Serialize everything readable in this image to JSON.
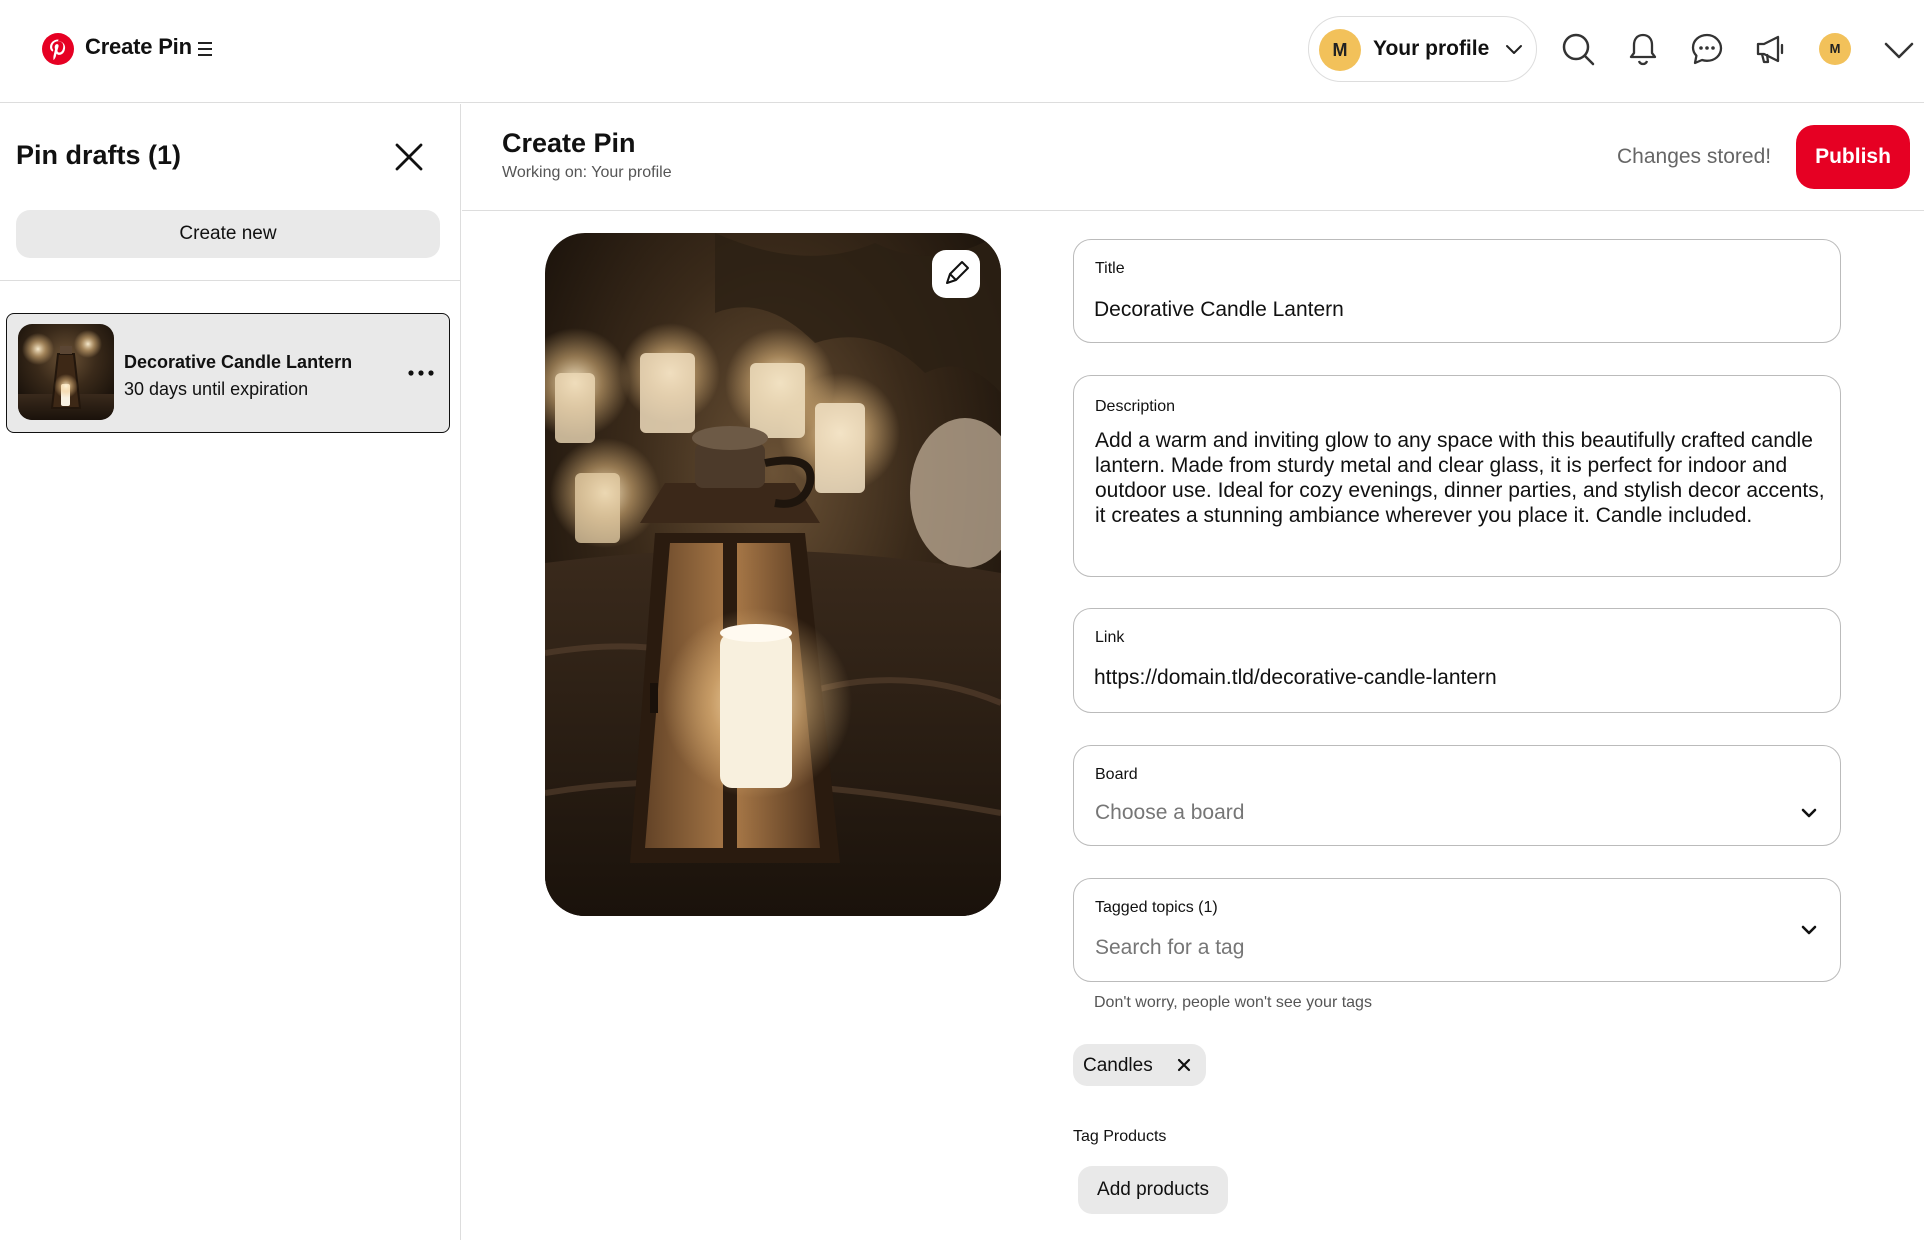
{
  "header": {
    "app_title": "Create Pin",
    "profile": {
      "initial": "M",
      "label": "Your profile"
    },
    "avatar_initial": "M",
    "brand_color": "#e60023"
  },
  "sidebar": {
    "title": "Pin drafts (1)",
    "create_new_label": "Create new",
    "drafts": [
      {
        "title": "Decorative Candle Lantern",
        "subtitle": "30 days until expiration"
      }
    ]
  },
  "main": {
    "title": "Create Pin",
    "subtitle": "Working on: Your profile",
    "status": "Changes stored!",
    "publish_label": "Publish"
  },
  "form": {
    "title": {
      "label": "Title",
      "value": "Decorative Candle Lantern"
    },
    "description": {
      "label": "Description",
      "value": "Add a warm and inviting glow to any space with this beautifully crafted candle lantern. Made from sturdy metal and clear glass, it is perfect for indoor and outdoor use. Ideal for cozy evenings, dinner parties, and stylish decor accents, it creates a stunning ambiance wherever you place it. Candle included."
    },
    "link": {
      "label": "Link",
      "value": "https://domain.tld/decorative-candle-lantern"
    },
    "board": {
      "label": "Board",
      "placeholder": "Choose a board"
    },
    "tagged_topics": {
      "label": "Tagged topics (1)",
      "placeholder": "Search for a tag",
      "helper": "Don't worry, people won't see your tags",
      "tags": [
        "Candles"
      ]
    },
    "tag_products": {
      "label": "Tag Products",
      "button_label": "Add products"
    }
  }
}
